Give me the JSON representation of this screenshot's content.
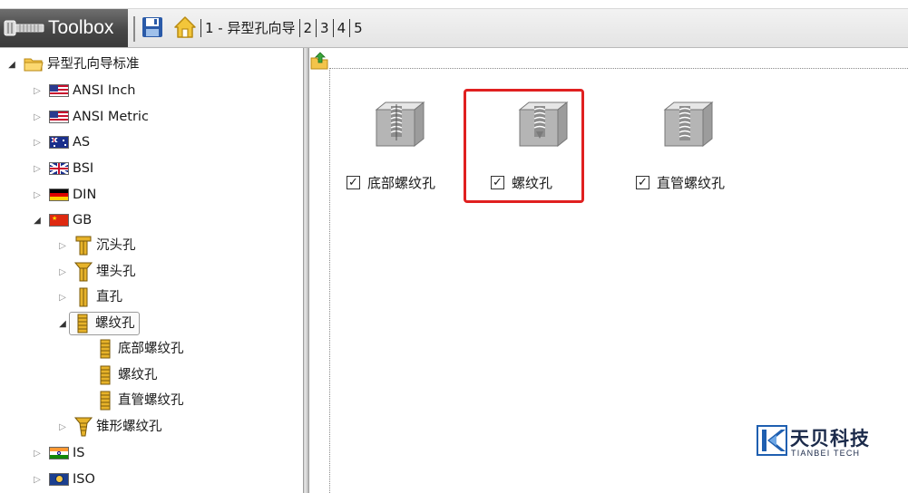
{
  "header": {
    "toolbox_label": "Toolbox",
    "breadcrumb": [
      {
        "label": "1 - 异型孔向导"
      },
      {
        "label": "2"
      },
      {
        "label": "3"
      },
      {
        "label": "4"
      },
      {
        "label": "5"
      }
    ]
  },
  "tree": {
    "root": "异型孔向导标准",
    "standards": {
      "ansi_inch": "ANSI Inch",
      "ansi_metric": "ANSI Metric",
      "as": "AS",
      "bsi": "BSI",
      "din": "DIN",
      "gb": "GB",
      "is": "IS",
      "iso": "ISO"
    },
    "gb_children": {
      "counterbore": "沉头孔",
      "countersink": "埋头孔",
      "straight": "直孔",
      "tapped": "螺纹孔",
      "tapered": "锥形螺纹孔"
    },
    "tapped_children": {
      "bottoming": "底部螺纹孔",
      "tapped": "螺纹孔",
      "pipe": "直管螺纹孔"
    }
  },
  "content": {
    "items": [
      {
        "label": "底部螺纹孔",
        "checked": true
      },
      {
        "label": "螺纹孔",
        "checked": true
      },
      {
        "label": "直管螺纹孔",
        "checked": true
      }
    ],
    "check_glyph": "✓"
  },
  "logo": {
    "cn": "天贝科技",
    "en": "TIANBEI TECH"
  },
  "colors": {
    "highlight": "#e02020",
    "header_dark": "#474747",
    "folder": "#f0c040",
    "bolt": "#d8a320"
  }
}
